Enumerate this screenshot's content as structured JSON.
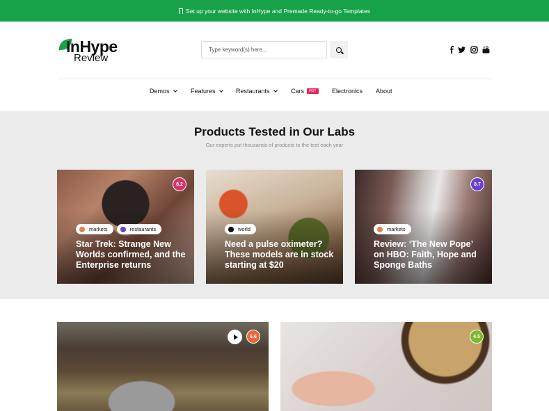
{
  "topbar": {
    "text": "Set up your website with InHype and Premade Ready-to-go Templates"
  },
  "logo": {
    "line1": "InHype",
    "line2": "Review"
  },
  "search": {
    "placeholder": "Type keyword(s) here..."
  },
  "social": [
    "facebook-icon",
    "twitter-icon",
    "instagram-icon",
    "youtube-icon"
  ],
  "nav": {
    "items": [
      {
        "label": "Demos",
        "dropdown": true
      },
      {
        "label": "Features",
        "dropdown": true
      },
      {
        "label": "Restaurants",
        "dropdown": true
      },
      {
        "label": "Cars",
        "badge": "HOT"
      },
      {
        "label": "Electronics"
      },
      {
        "label": "About"
      }
    ]
  },
  "section": {
    "title": "Products Tested in Our Labs",
    "subtitle": "Our experts put thousands of products to the test each year"
  },
  "cards": [
    {
      "score": "8.2",
      "score_color": "#d6336c",
      "tags": [
        {
          "label": "markets",
          "color": "#e8804a"
        },
        {
          "label": "restaurants",
          "color": "#6a3fd6"
        }
      ],
      "title": "Star Trek: Strange New Worlds confirmed, and the Enterprise returns"
    },
    {
      "score": null,
      "tags": [
        {
          "label": "world",
          "color": "#111111"
        }
      ],
      "title": "Need a pulse oximeter? These models are in stock starting at $20"
    },
    {
      "score": "8.7",
      "score_color": "#6a3fd6",
      "tags": [
        {
          "label": "markets",
          "color": "#e8804a"
        }
      ],
      "title": "Review: ‘The New Pope’ on HBO: Faith, Hope and Sponge Baths"
    }
  ],
  "bottom_cards": [
    {
      "score": "6.6",
      "score_color": "#e8693a",
      "has_play": true
    },
    {
      "score": "4.5",
      "score_color": "#7fb82e",
      "has_play": false
    }
  ],
  "colors": {
    "brand_green": "#17a24a",
    "hot_badge": "#e8245f"
  }
}
